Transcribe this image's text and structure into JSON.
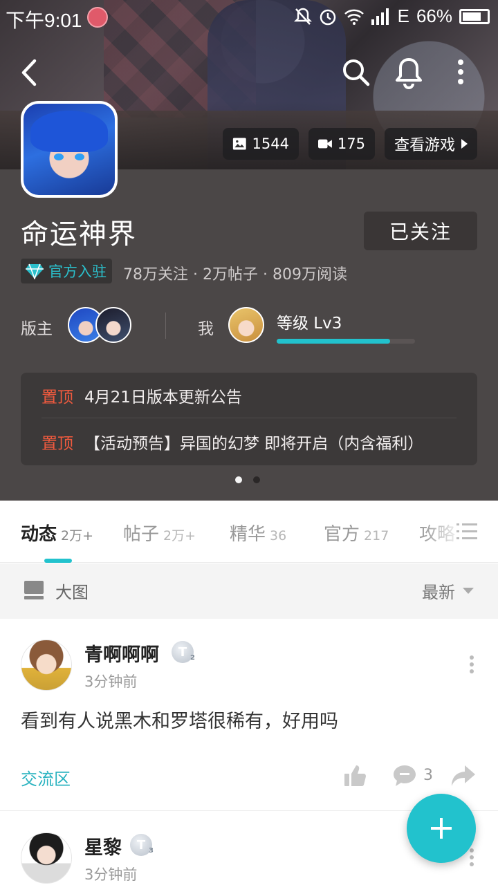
{
  "status_bar": {
    "time": "下午9:01",
    "network": "E",
    "battery": "66%"
  },
  "header": {
    "back_icon": "chevron-left-icon",
    "search_icon": "search-icon",
    "bell_icon": "bell-icon",
    "more_icon": "more-vertical-icon",
    "photo_count": "1544",
    "video_count": "175",
    "view_game_label": "查看游戏"
  },
  "forum": {
    "title": "命运神界",
    "follow_label": "已关注",
    "official_label": "官方入驻",
    "stats": "78万关注 · 2万帖子 · 809万阅读",
    "moderator_label": "版主",
    "me_label": "我",
    "level_label": "等级 Lv3",
    "level_progress": 0.82
  },
  "notices": [
    {
      "tag": "置顶",
      "text": "4月21日版本更新公告"
    },
    {
      "tag": "置顶",
      "text": "【活动预告】异国的幻梦 即将开启（内含福利）"
    }
  ],
  "tabs": [
    {
      "label": "动态",
      "count": "2万+"
    },
    {
      "label": "帖子",
      "count": "2万+"
    },
    {
      "label": "精华",
      "count": "36"
    },
    {
      "label": "官方",
      "count": "217"
    },
    {
      "label": "攻略",
      "count": ""
    }
  ],
  "filter": {
    "view_label": "大图",
    "sort_label": "最新"
  },
  "posts": [
    {
      "username": "青啊啊啊",
      "badge": "T",
      "badge_level": "2",
      "time": "3分钟前",
      "text": "看到有人说黑木和罗塔很稀有，好用吗",
      "section": "交流区",
      "comment_count": "3"
    },
    {
      "username": "星黎",
      "badge": "T",
      "badge_level": "3",
      "time": "3分钟前"
    }
  ],
  "colors": {
    "accent": "#22c2cd",
    "notice_tag": "#f05a3e",
    "header_bg": "#4b4747"
  }
}
